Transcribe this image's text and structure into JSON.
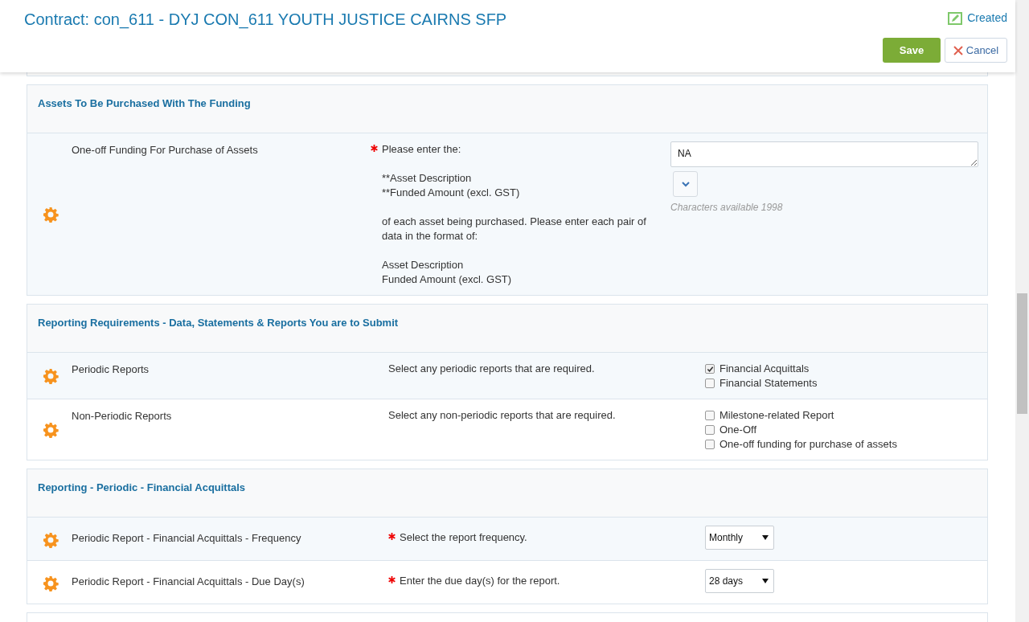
{
  "header": {
    "title": "Contract: con_611 - DYJ CON_611 YOUTH JUSTICE CAIRNS SFP",
    "status": "Created",
    "buttons": [
      {
        "label": "Save",
        "kind": "primary"
      },
      {
        "label": "Cancel",
        "kind": "cancel"
      }
    ]
  },
  "sections": [
    {
      "title": "Assets To Be Purchased With The Funding",
      "rows": [
        {
          "kind": "textarea",
          "label": "One-off Funding For Purchase of Assets",
          "required": true,
          "description": "Please enter the:\n\n**Asset Description\n**Funded Amount (excl. GST)\n\nof each asset being purchased. Please enter each pair of data in the format of:\n\nAsset Description\nFunded Amount (excl. GST)",
          "value": "NA",
          "counter": "Characters available 1998"
        }
      ]
    },
    {
      "title": "Reporting Requirements - Data, Statements & Reports You are to Submit",
      "rows": [
        {
          "kind": "checkboxes",
          "label": "Periodic Reports",
          "required": false,
          "description": "Select any periodic reports that are required.",
          "options": [
            {
              "label": "Financial Acquittals",
              "checked": true
            },
            {
              "label": "Financial Statements",
              "checked": false
            }
          ]
        },
        {
          "kind": "checkboxes",
          "label": "Non-Periodic Reports",
          "required": false,
          "description": "Select any non-periodic reports that are required.",
          "options": [
            {
              "label": "Milestone-related Report",
              "checked": false
            },
            {
              "label": "One-Off",
              "checked": false
            },
            {
              "label": "One-off funding for purchase of assets",
              "checked": false
            }
          ]
        }
      ]
    },
    {
      "title": "Reporting - Periodic - Financial Acquittals",
      "rows": [
        {
          "kind": "select",
          "label": "Periodic Report - Financial Acquittals - Frequency",
          "required": true,
          "description": "Select the report frequency.",
          "value": "Monthly"
        },
        {
          "kind": "select",
          "label": "Periodic Report - Financial Acquittals - Due Day(s)",
          "required": true,
          "description": "Enter the due day(s) for the report.",
          "value": "28 days"
        }
      ]
    }
  ]
}
